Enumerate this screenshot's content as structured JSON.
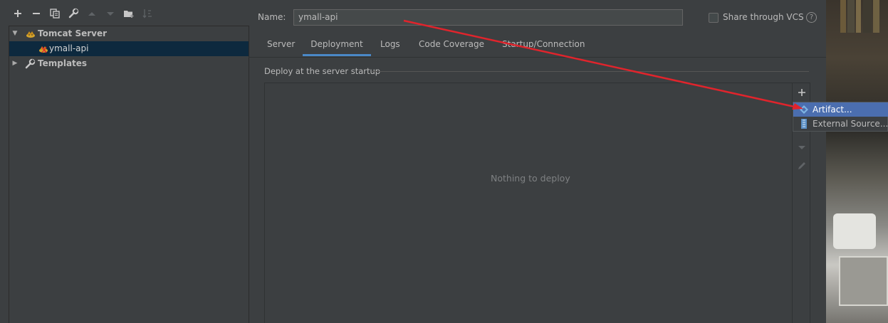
{
  "toolbar": {
    "icons": [
      "add-icon",
      "remove-icon",
      "copy-icon",
      "wrench-icon",
      "move-up-icon",
      "move-down-icon",
      "new-folder-icon",
      "sort-icon"
    ]
  },
  "tree": {
    "items": [
      {
        "label": "Tomcat Server",
        "icon": "tomcat-icon",
        "expanded": true
      },
      {
        "label": "ymall-api",
        "icon": "tomcat-config-icon",
        "selected": true
      },
      {
        "label": "Templates",
        "icon": "wrench-icon",
        "expanded": false
      }
    ]
  },
  "form": {
    "name_label": "Name:",
    "name_value": "ymall-api",
    "share_label": "Share through VCS",
    "share_checked": false
  },
  "tabs": [
    "Server",
    "Deployment",
    "Logs",
    "Code Coverage",
    "Startup/Connection"
  ],
  "active_tab": "Deployment",
  "deployment": {
    "section_title": "Deploy at the server startup",
    "empty_text": "Nothing to deploy"
  },
  "popup": {
    "items": [
      {
        "label": "Artifact...",
        "icon": "artifact-icon",
        "highlighted": true
      },
      {
        "label": "External Source...",
        "icon": "external-source-icon",
        "highlighted": false
      }
    ]
  },
  "colors": {
    "background": "#3c3f41",
    "selection": "#0d293e",
    "active_tab_underline": "#4a88c7",
    "popup_highlight": "#4b6eaf",
    "annotation_arrow": "#e0242c"
  }
}
